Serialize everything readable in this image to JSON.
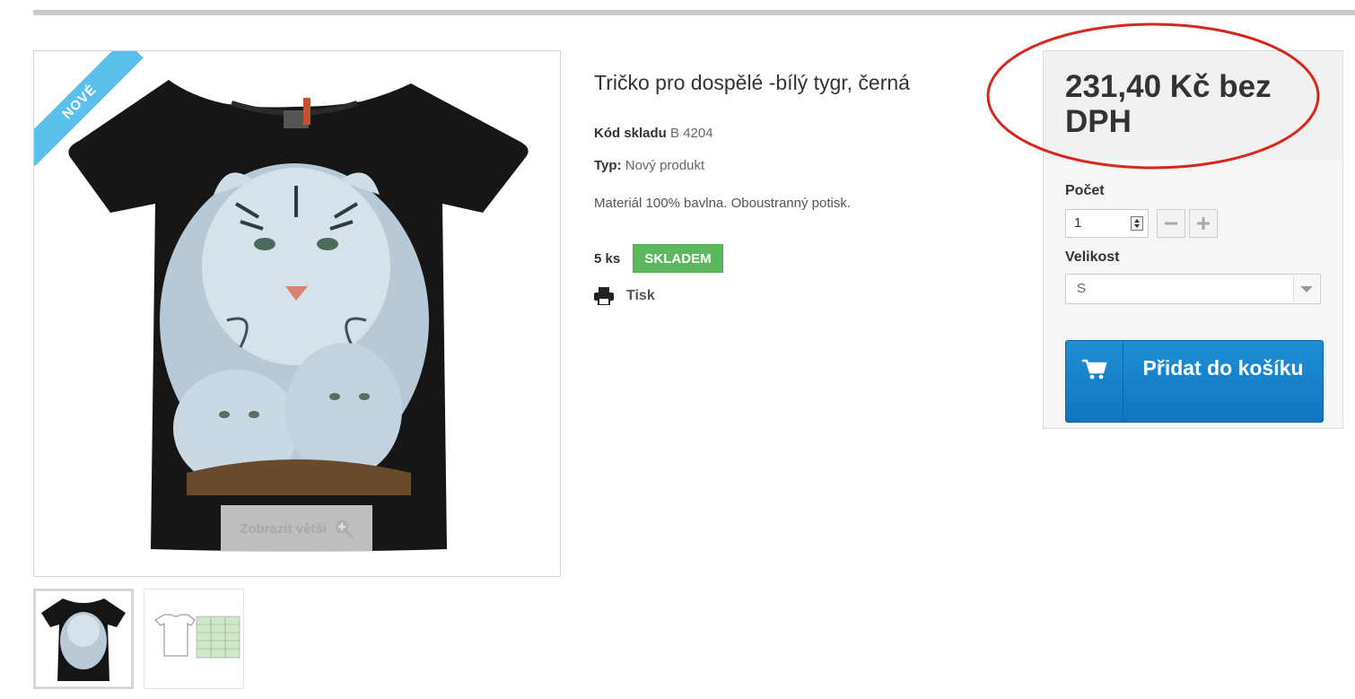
{
  "product": {
    "badge": "NOVÉ",
    "title": "Tričko pro dospělé -bílý tygr, černá",
    "sku_label": "Kód skladu",
    "sku_value": "B 4204",
    "type_label": "Typ:",
    "type_value": "Nový produkt",
    "description": "Materiál 100% bavlna. Oboustranný potisk.",
    "stock_qty": "5 ks",
    "stock_status": "SKLADEM",
    "print_label": "Tisk",
    "zoom_label": "Zobrazit větší"
  },
  "buy_box": {
    "price": "231,40 Kč bez DPH",
    "qty_label": "Počet",
    "qty_value": "1",
    "size_label": "Velikost",
    "size_value": "S",
    "add_to_cart": "Přidat do košíku"
  },
  "colors": {
    "ribbon": "#5bc0eb",
    "in_stock": "#5cb85c",
    "cart_button": "#1a85cf",
    "annotation": "#d9261c"
  },
  "icons": [
    "zoom-in-icon",
    "printer-icon",
    "cart-icon",
    "minus-icon",
    "plus-icon",
    "chevron-down-icon"
  ]
}
